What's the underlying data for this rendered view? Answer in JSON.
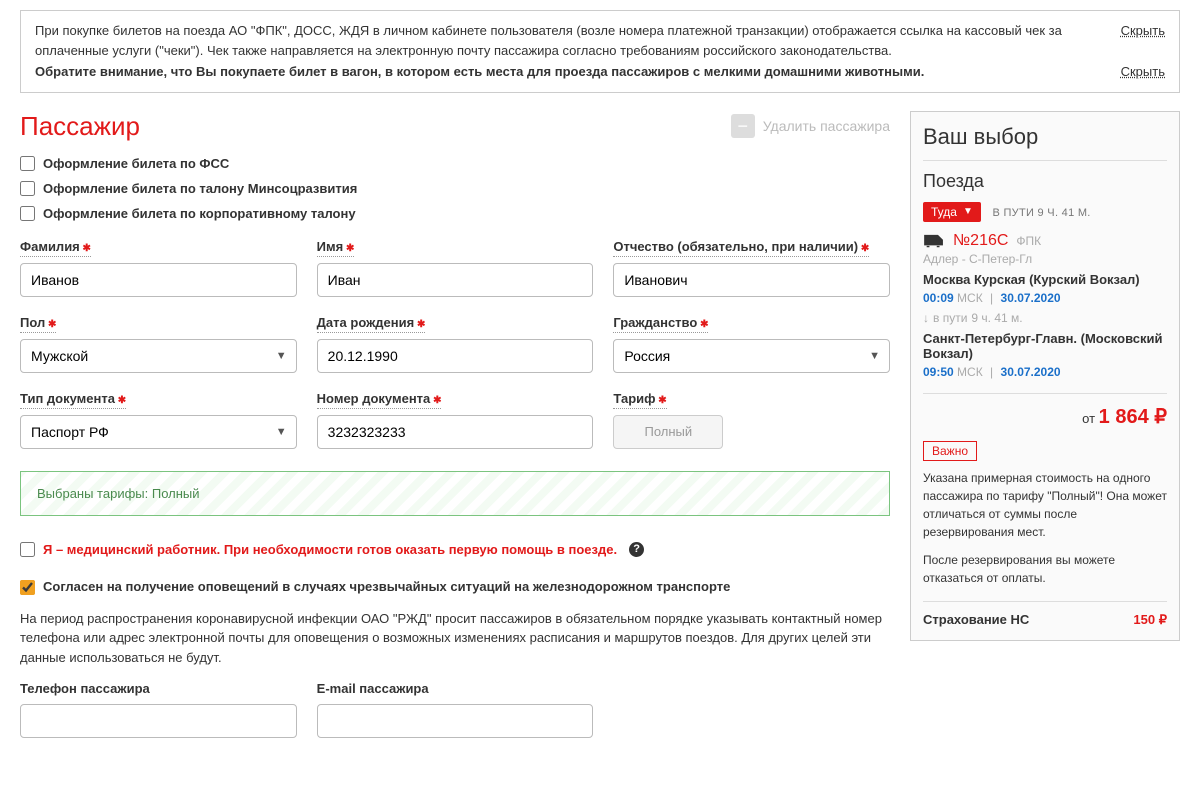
{
  "notices": [
    {
      "text": "При покупке билетов на поезда АО \"ФПК\", ДОСС, ЖДЯ в личном кабинете пользователя (возле номера платежной транзакции) отображается ссылка на кассовый чек за оплаченные услуги (\"чеки\"). Чек также направляется на электронную почту пассажира согласно требованиям российского законодательства.",
      "hide": "Скрыть"
    },
    {
      "text": "Обратите внимание, что Вы покупаете билет в вагон, в котором есть места для проезда пассажиров с мелкими домашними животными.",
      "hide": "Скрыть",
      "bold": true
    }
  ],
  "passenger": {
    "title": "Пассажир",
    "delete": "Удалить пассажира",
    "chk_fss": "Оформление билета по ФСС",
    "chk_minsoc": "Оформление билета по талону Минсоцразвития",
    "chk_corp": "Оформление билета по корпоративному талону",
    "labels": {
      "lastname": "Фамилия",
      "firstname": "Имя",
      "middlename": "Отчество (обязательно, при наличии)",
      "gender": "Пол",
      "dob": "Дата рождения",
      "citizenship": "Гражданство",
      "doctype": "Тип документа",
      "docnum": "Номер документа",
      "tariff": "Тариф",
      "phone": "Телефон пассажира",
      "email": "E-mail пассажира"
    },
    "values": {
      "lastname": "Иванов",
      "firstname": "Иван",
      "middlename": "Иванович",
      "gender": "Мужской",
      "dob": "20.12.1990",
      "citizenship": "Россия",
      "doctype": "Паспорт РФ",
      "docnum": "3232323233",
      "tariff": "Полный"
    },
    "tariff_banner": "Выбраны тарифы: Полный",
    "med_chk": "Я – медицинский работник. При необходимости готов оказать первую помощь в поезде.",
    "agree_chk": "Согласен на получение оповещений в случаях чрезвычайных ситуаций на железнодорожном транспорте",
    "info_text": "На период распространения коронавирусной инфекции ОАО \"РЖД\" просит пассажиров в обязательном порядке указывать контактный номер телефона или адрес электронной почты для оповещения о возможных изменениях расписания и маршрутов поездов. Для других целей эти данные использоваться не будут."
  },
  "sidebar": {
    "title": "Ваш выбор",
    "trains": "Поезда",
    "dir": "Туда",
    "duration": "В ПУТИ 9 Ч. 41 М.",
    "train_no": "№216С",
    "company": "ФПК",
    "route_small": "Адлер - С-Петер-Гл",
    "from_station": "Москва Курская (Курский Вокзал)",
    "from_time": "00:09",
    "from_tz": "МСК",
    "from_date": "30.07.2020",
    "dur_label": "в пути",
    "dur_val": "9 ч. 41 м.",
    "to_station": "Санкт-Петербург-Главн. (Московский Вокзал)",
    "to_time": "09:50",
    "to_tz": "МСК",
    "to_date": "30.07.2020",
    "price_prefix": "от",
    "price": "1 864 ₽",
    "important_label": "Важно",
    "important_text1": "Указана примерная стоимость на одного пассажира по тарифу \"Полный\"! Она может отличаться от суммы после резервирования мест.",
    "important_text2": "После резервирования вы можете отказаться от оплаты.",
    "insurance": "Страхование НС",
    "insurance_price": "150 ₽"
  }
}
